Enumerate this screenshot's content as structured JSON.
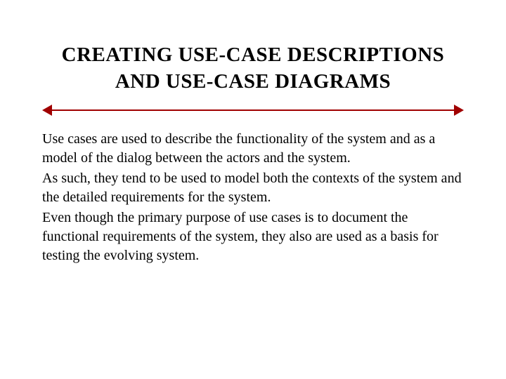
{
  "title": "CREATING USE-CASE DESCRIPTIONS AND USE-CASE DIAGRAMS",
  "paragraphs": {
    "p1": "Use cases are used to describe the functionality of the system and as a model of the dialog between the actors and the system.",
    "p2": "As such, they tend to be used to model both the contexts of the system and the detailed requirements for the system.",
    "p3": "Even though the primary purpose of use cases is to document the functional requirements of the system, they also are used as a basis for testing the evolving system."
  },
  "accent_color": "#a00000"
}
